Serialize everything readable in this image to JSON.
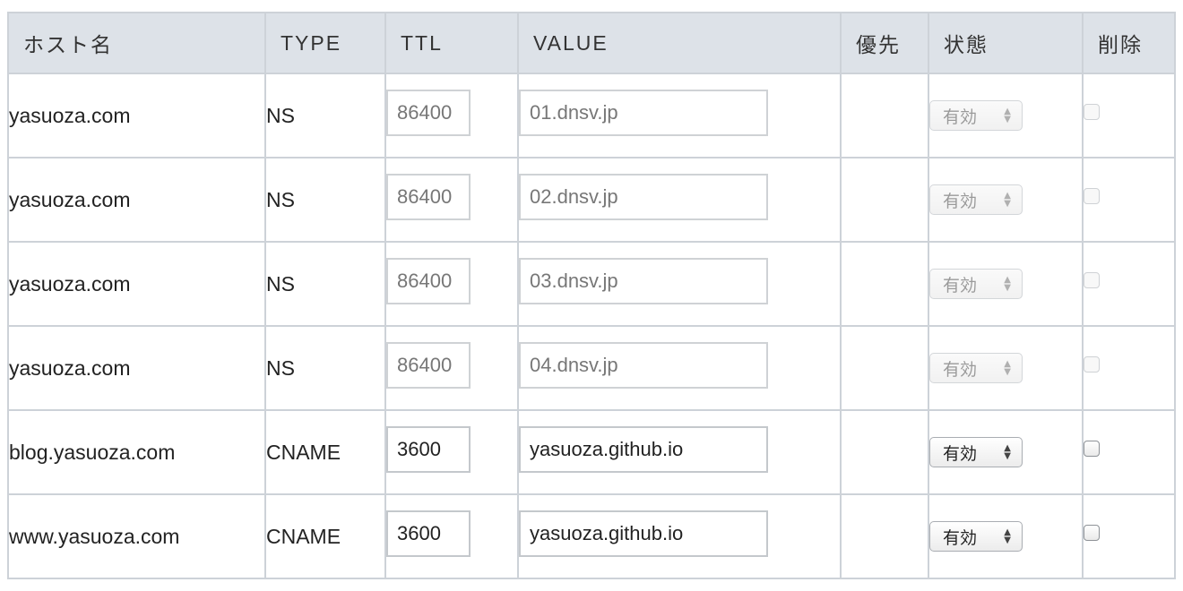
{
  "headers": {
    "host": "ホスト名",
    "type": "TYPE",
    "ttl": "TTL",
    "value": "VALUE",
    "priority": "優先",
    "status": "状態",
    "delete": "削除"
  },
  "rows": [
    {
      "host": "yasuoza.com",
      "type": "NS",
      "ttl": "86400",
      "value": "01.dnsv.jp",
      "priority": "",
      "status": "有効",
      "editable": false
    },
    {
      "host": "yasuoza.com",
      "type": "NS",
      "ttl": "86400",
      "value": "02.dnsv.jp",
      "priority": "",
      "status": "有効",
      "editable": false
    },
    {
      "host": "yasuoza.com",
      "type": "NS",
      "ttl": "86400",
      "value": "03.dnsv.jp",
      "priority": "",
      "status": "有効",
      "editable": false
    },
    {
      "host": "yasuoza.com",
      "type": "NS",
      "ttl": "86400",
      "value": "04.dnsv.jp",
      "priority": "",
      "status": "有効",
      "editable": false
    },
    {
      "host": "blog.yasuoza.com",
      "type": "CNAME",
      "ttl": "3600",
      "value": "yasuoza.github.io",
      "priority": "",
      "status": "有効",
      "editable": true
    },
    {
      "host": "www.yasuoza.com",
      "type": "CNAME",
      "ttl": "3600",
      "value": "yasuoza.github.io",
      "priority": "",
      "status": "有効",
      "editable": true
    }
  ],
  "colors": {
    "header_bg": "#dde2e8",
    "border": "#cdd2d8",
    "disabled_text": "#777777"
  },
  "icons": {
    "select_arrows": "up-down-arrows-icon"
  }
}
